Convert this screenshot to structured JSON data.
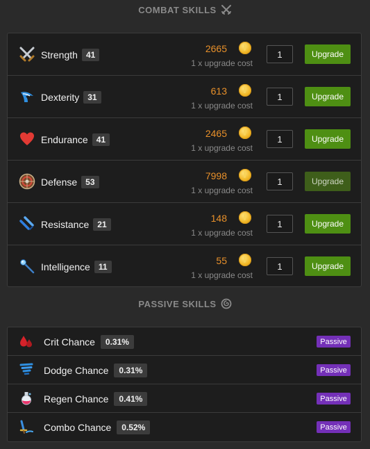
{
  "combat": {
    "title": "COMBAT SKILLS",
    "title_icon": "crossed-swords-icon",
    "skills": [
      {
        "name": "Strength",
        "level": "41",
        "cost": "2665",
        "cost_note": "1 x upgrade cost",
        "quantity": "1",
        "button": "Upgrade",
        "icon": "crossed-swords-icon",
        "enabled": true
      },
      {
        "name": "Dexterity",
        "level": "31",
        "cost": "613",
        "cost_note": "1 x upgrade cost",
        "quantity": "1",
        "button": "Upgrade",
        "icon": "winged-boot-icon",
        "enabled": true
      },
      {
        "name": "Endurance",
        "level": "41",
        "cost": "2465",
        "cost_note": "1 x upgrade cost",
        "quantity": "1",
        "button": "Upgrade",
        "icon": "heart-icon",
        "enabled": true
      },
      {
        "name": "Defense",
        "level": "53",
        "cost": "7998",
        "cost_note": "1 x upgrade cost",
        "quantity": "1",
        "button": "Upgrade",
        "icon": "round-shield-icon",
        "enabled": false
      },
      {
        "name": "Resistance",
        "level": "21",
        "cost": "148",
        "cost_note": "1 x upgrade cost",
        "quantity": "1",
        "button": "Upgrade",
        "icon": "blue-blades-icon",
        "enabled": true
      },
      {
        "name": "Intelligence",
        "level": "11",
        "cost": "55",
        "cost_note": "1 x upgrade cost",
        "quantity": "1",
        "button": "Upgrade",
        "icon": "magic-wand-icon",
        "enabled": true
      }
    ]
  },
  "passive": {
    "title": "PASSIVE SKILLS",
    "title_icon": "swirl-icon",
    "skills": [
      {
        "name": "Crit Chance",
        "value": "0.31%",
        "tag": "Passive",
        "icon": "blood-drops-icon"
      },
      {
        "name": "Dodge Chance",
        "value": "0.31%",
        "tag": "Passive",
        "icon": "tornado-icon"
      },
      {
        "name": "Regen Chance",
        "value": "0.41%",
        "tag": "Passive",
        "icon": "potion-icon"
      },
      {
        "name": "Combo Chance",
        "value": "0.52%",
        "tag": "Passive",
        "icon": "sword-strike-icon"
      }
    ]
  },
  "colors": {
    "background": "#2a2a2a",
    "panel": "#1d1d1d",
    "cost": "#e8902a",
    "upgrade_button": "#4e8f13",
    "upgrade_button_disabled": "#3e5e1a",
    "passive_tag": "#7430b8"
  }
}
